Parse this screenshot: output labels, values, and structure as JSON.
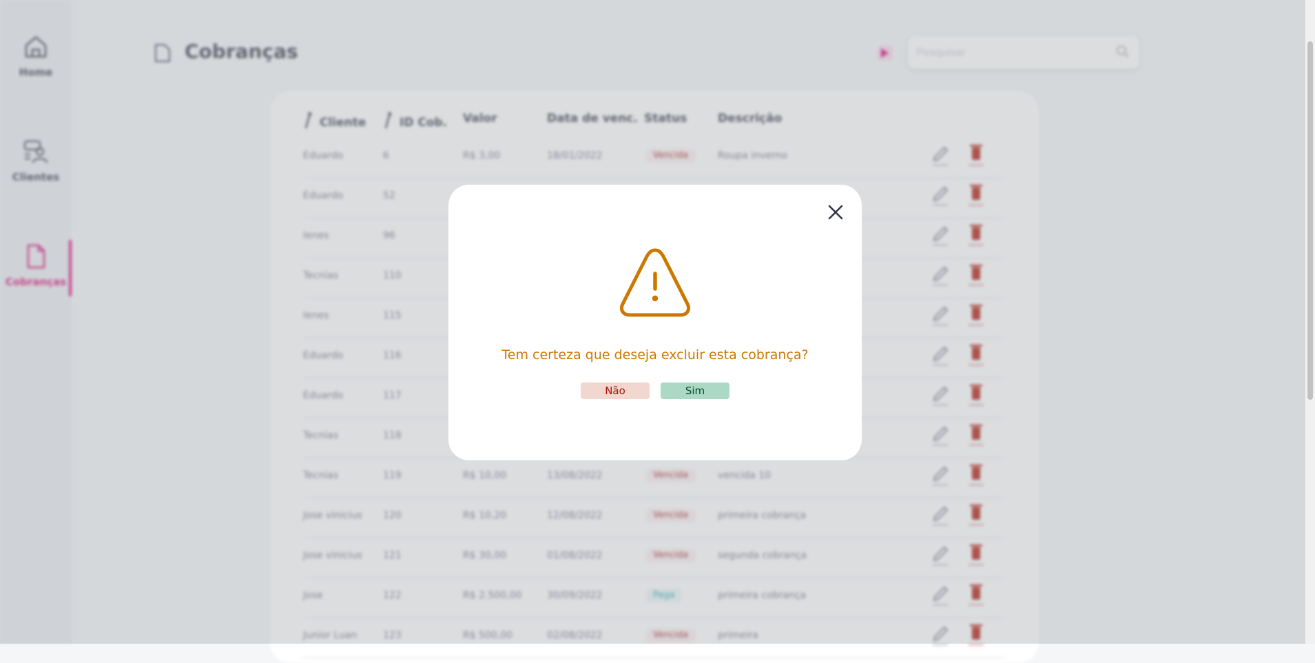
{
  "sidebar": {
    "items": [
      {
        "label": "Home",
        "icon": "home-icon"
      },
      {
        "label": "Clientes",
        "icon": "clients-icon"
      },
      {
        "label": "Cobranças",
        "icon": "document-icon",
        "active": true
      }
    ]
  },
  "header": {
    "title": "Cobranças",
    "search_placeholder": "Pesquisar"
  },
  "table": {
    "columns": [
      "Cliente",
      "ID Cob.",
      "Valor",
      "Data de venc.",
      "Status",
      "Descrição"
    ],
    "rows": [
      {
        "cliente": "Eduardo",
        "id": "6",
        "valor": "R$ 3,00",
        "data": "18/01/2022",
        "status": "Vencida",
        "descricao": "Roupa inverno"
      },
      {
        "cliente": "Eduardo",
        "id": "52",
        "valor": "",
        "data": "",
        "status": "",
        "descricao": ""
      },
      {
        "cliente": "Ienes",
        "id": "96",
        "valor": "",
        "data": "",
        "status": "",
        "descricao": ""
      },
      {
        "cliente": "Tecnias",
        "id": "110",
        "valor": "",
        "data": "",
        "status": "",
        "descricao": ""
      },
      {
        "cliente": "Ienes",
        "id": "115",
        "valor": "",
        "data": "",
        "status": "",
        "descricao": ""
      },
      {
        "cliente": "Eduardo",
        "id": "116",
        "valor": "",
        "data": "",
        "status": "",
        "descricao": ""
      },
      {
        "cliente": "Eduardo",
        "id": "117",
        "valor": "",
        "data": "",
        "status": "",
        "descricao": ""
      },
      {
        "cliente": "Tecnias",
        "id": "118",
        "valor": "",
        "data": "",
        "status": "",
        "descricao": ""
      },
      {
        "cliente": "Tecnias",
        "id": "119",
        "valor": "R$ 10,00",
        "data": "13/08/2022",
        "status": "Vencida",
        "descricao": "vencida 10"
      },
      {
        "cliente": "Jose vinicius",
        "id": "120",
        "valor": "R$ 10,20",
        "data": "12/08/2022",
        "status": "Vencida",
        "descricao": "primeira cobrança"
      },
      {
        "cliente": "Jose vinicius",
        "id": "121",
        "valor": "R$ 30,00",
        "data": "01/08/2022",
        "status": "Vencida",
        "descricao": "segunda cobrança"
      },
      {
        "cliente": "Jose",
        "id": "122",
        "valor": "R$ 2.500,00",
        "data": "30/09/2022",
        "status": "Paga",
        "descricao": "primeira cobrança"
      },
      {
        "cliente": "Junior Luan",
        "id": "123",
        "valor": "R$ 500,00",
        "data": "02/08/2022",
        "status": "Vencida",
        "descricao": "primeira"
      }
    ],
    "edit_label": "Editar",
    "delete_label": "Excluir"
  },
  "modal": {
    "message": "Tem certeza que deseja excluir esta cobrança?",
    "no_label": "Não",
    "yes_label": "Sim"
  },
  "colors": {
    "accent": "#da0175",
    "warning": "#cc7800",
    "text_dark": "#343447"
  }
}
